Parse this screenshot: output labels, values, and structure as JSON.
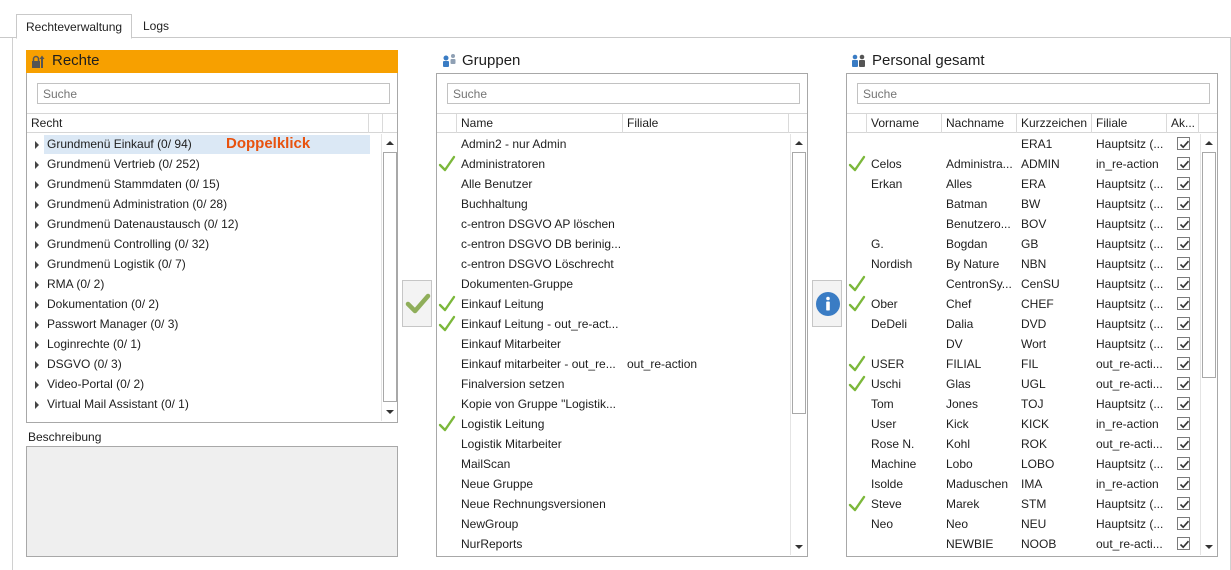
{
  "tabs": [
    {
      "label": "Rechteverwaltung",
      "active": true
    },
    {
      "label": "Logs",
      "active": false
    }
  ],
  "rechte": {
    "title": "Rechte",
    "search_placeholder": "Suche",
    "column": "Recht",
    "annotation": "Doppelklick",
    "items": [
      "Grundmenü Einkauf (0/ 94)",
      "Grundmenü Vertrieb (0/ 252)",
      "Grundmenü Stammdaten (0/ 15)",
      "Grundmenü Administration (0/ 28)",
      "Grundmenü Datenaustausch (0/ 12)",
      "Grundmenü Controlling (0/ 32)",
      "Grundmenü Logistik (0/ 7)",
      "RMA (0/ 2)",
      "Dokumentation (0/ 2)",
      "Passwort Manager (0/ 3)",
      "Loginrechte (0/ 1)",
      "DSGVO (0/ 3)",
      "Video-Portal (0/ 2)",
      "Virtual Mail Assistant (0/ 1)"
    ],
    "description_label": "Beschreibung"
  },
  "gruppen": {
    "title": "Gruppen",
    "search_placeholder": "Suche",
    "columns": [
      "Name",
      "Filiale"
    ],
    "rows": [
      {
        "check": false,
        "name": "Admin2 - nur Admin",
        "filiale": ""
      },
      {
        "check": true,
        "name": "Administratoren",
        "filiale": ""
      },
      {
        "check": false,
        "name": "Alle Benutzer",
        "filiale": ""
      },
      {
        "check": false,
        "name": "Buchhaltung",
        "filiale": ""
      },
      {
        "check": false,
        "name": "c-entron DSGVO AP löschen",
        "filiale": ""
      },
      {
        "check": false,
        "name": "c-entron DSGVO DB berinig...",
        "filiale": ""
      },
      {
        "check": false,
        "name": "c-entron DSGVO Löschrecht",
        "filiale": ""
      },
      {
        "check": false,
        "name": "Dokumenten-Gruppe",
        "filiale": ""
      },
      {
        "check": true,
        "name": "Einkauf Leitung",
        "filiale": ""
      },
      {
        "check": true,
        "name": "Einkauf Leitung - out_re-act...",
        "filiale": ""
      },
      {
        "check": false,
        "name": "Einkauf Mitarbeiter",
        "filiale": ""
      },
      {
        "check": false,
        "name": "Einkauf mitarbeiter - out_re...",
        "filiale": "out_re-action"
      },
      {
        "check": false,
        "name": "Finalversion setzen",
        "filiale": ""
      },
      {
        "check": false,
        "name": "Kopie von Gruppe \"Logistik...",
        "filiale": ""
      },
      {
        "check": true,
        "name": "Logistik Leitung",
        "filiale": ""
      },
      {
        "check": false,
        "name": "Logistik Mitarbeiter",
        "filiale": ""
      },
      {
        "check": false,
        "name": "MailScan",
        "filiale": ""
      },
      {
        "check": false,
        "name": "Neue Gruppe",
        "filiale": ""
      },
      {
        "check": false,
        "name": "Neue Rechnungsversionen",
        "filiale": ""
      },
      {
        "check": false,
        "name": "NewGroup",
        "filiale": ""
      },
      {
        "check": false,
        "name": "NurReports",
        "filiale": ""
      }
    ]
  },
  "personal": {
    "title": "Personal gesamt",
    "search_placeholder": "Suche",
    "columns": [
      "Vorname",
      "Nachname",
      "Kurzzeichen",
      "Filiale",
      "Ak..."
    ],
    "rows": [
      {
        "check": false,
        "vorname": "",
        "nachname": "",
        "kurz": "ERA1",
        "filiale": "Hauptsitz (...",
        "aktiv": true
      },
      {
        "check": true,
        "vorname": "Celos",
        "nachname": "Administra...",
        "kurz": "ADMIN",
        "filiale": "in_re-action",
        "aktiv": true
      },
      {
        "check": false,
        "vorname": "Erkan",
        "nachname": "Alles",
        "kurz": "ERA",
        "filiale": "Hauptsitz (...",
        "aktiv": true
      },
      {
        "check": false,
        "vorname": "",
        "nachname": "Batman",
        "kurz": "BW",
        "filiale": "Hauptsitz (...",
        "aktiv": true
      },
      {
        "check": false,
        "vorname": "",
        "nachname": "Benutzero...",
        "kurz": "BOV",
        "filiale": "Hauptsitz (...",
        "aktiv": true
      },
      {
        "check": false,
        "vorname": "G.",
        "nachname": "Bogdan",
        "kurz": "GB",
        "filiale": "Hauptsitz (...",
        "aktiv": true
      },
      {
        "check": false,
        "vorname": "Nordish",
        "nachname": "By Nature",
        "kurz": "NBN",
        "filiale": "Hauptsitz (...",
        "aktiv": true
      },
      {
        "check": true,
        "vorname": "",
        "nachname": "CentronSy...",
        "kurz": "CenSU",
        "filiale": "Hauptsitz (...",
        "aktiv": true
      },
      {
        "check": true,
        "vorname": "Ober",
        "nachname": "Chef",
        "kurz": "CHEF",
        "filiale": "Hauptsitz (...",
        "aktiv": true
      },
      {
        "check": false,
        "vorname": "DeDeli",
        "nachname": "Dalia",
        "kurz": "DVD",
        "filiale": "Hauptsitz (...",
        "aktiv": true
      },
      {
        "check": false,
        "vorname": "",
        "nachname": "DV",
        "kurz": "Wort",
        "filiale": "Hauptsitz (...",
        "aktiv": true
      },
      {
        "check": true,
        "vorname": "USER",
        "nachname": "FILIAL",
        "kurz": "FIL",
        "filiale": "out_re-acti...",
        "aktiv": true
      },
      {
        "check": true,
        "vorname": "Uschi",
        "nachname": "Glas",
        "kurz": "UGL",
        "filiale": "out_re-acti...",
        "aktiv": true
      },
      {
        "check": false,
        "vorname": "Tom",
        "nachname": "Jones",
        "kurz": "TOJ",
        "filiale": "Hauptsitz (...",
        "aktiv": true
      },
      {
        "check": false,
        "vorname": "User",
        "nachname": "Kick",
        "kurz": "KICK",
        "filiale": "in_re-action",
        "aktiv": true
      },
      {
        "check": false,
        "vorname": "Rose N.",
        "nachname": "Kohl",
        "kurz": "ROK",
        "filiale": "out_re-acti...",
        "aktiv": true
      },
      {
        "check": false,
        "vorname": "Machine",
        "nachname": "Lobo",
        "kurz": "LOBO",
        "filiale": "Hauptsitz (...",
        "aktiv": true
      },
      {
        "check": false,
        "vorname": "Isolde",
        "nachname": "Maduschen",
        "kurz": "IMA",
        "filiale": "in_re-action",
        "aktiv": true
      },
      {
        "check": true,
        "vorname": "Steve",
        "nachname": "Marek",
        "kurz": "STM",
        "filiale": "Hauptsitz (...",
        "aktiv": true
      },
      {
        "check": false,
        "vorname": "Neo",
        "nachname": "Neo",
        "kurz": "NEU",
        "filiale": "Hauptsitz (...",
        "aktiv": true
      },
      {
        "check": false,
        "vorname": "",
        "nachname": "NEWBIE",
        "kurz": "NOOB",
        "filiale": "out_re-acti...",
        "aktiv": true
      }
    ]
  },
  "colors": {
    "accent_orange": "#f7a000",
    "check_green": "#7cb83b",
    "annotation_red": "#e8520e",
    "info_blue": "#3a7cc4"
  }
}
